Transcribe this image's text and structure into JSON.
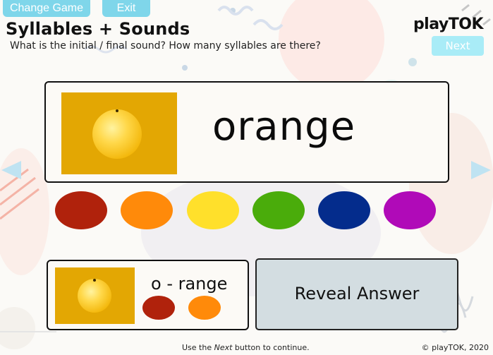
{
  "toolbar": {
    "change_game_label": "Change Game",
    "exit_label": "Exit",
    "next_label": "Next"
  },
  "header": {
    "title": "Syllables + Sounds",
    "subtitle": "What is the initial / final sound? How many syllables are there?",
    "logo": "playTOK"
  },
  "word_card": {
    "word": "orange",
    "image_icon": "orange-fruit-icon"
  },
  "color_dots": [
    {
      "name": "red",
      "color": "#b0220c"
    },
    {
      "name": "orange",
      "color": "#ff8a0a"
    },
    {
      "name": "yellow",
      "color": "#ffe02b"
    },
    {
      "name": "green",
      "color": "#4aac0b"
    },
    {
      "name": "blue",
      "color": "#042c8c"
    },
    {
      "name": "purple",
      "color": "#b00ab8"
    }
  ],
  "syllable_card": {
    "text": "o - range",
    "dots": [
      {
        "color": "#b0220c"
      },
      {
        "color": "#ff8a0a"
      }
    ]
  },
  "reveal_button": {
    "label": "Reveal Answer"
  },
  "footer": {
    "prefix": "Use the ",
    "emphasis": "Next",
    "suffix": " button to continue.",
    "copyright": "© playTOK, 2020"
  },
  "colors": {
    "accent_button": "#7fd6ea",
    "next_button": "#a9ecf7",
    "photo_bg": "#e3a703",
    "reveal_bg": "#d3dde1"
  }
}
